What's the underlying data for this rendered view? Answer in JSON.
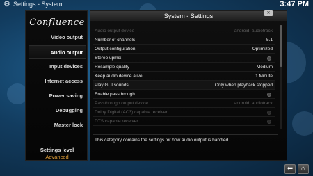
{
  "topbar": {
    "breadcrumb": "Settings - System",
    "clock": "3:47 PM"
  },
  "sidebar": {
    "logo": "Confluence",
    "items": [
      {
        "label": "Video output"
      },
      {
        "label": "Audio output"
      },
      {
        "label": "Input devices"
      },
      {
        "label": "Internet access"
      },
      {
        "label": "Power saving"
      },
      {
        "label": "Debugging"
      },
      {
        "label": "Master lock"
      }
    ],
    "active_index": 1,
    "settings_level_label": "Settings level",
    "settings_level_value": "Advanced"
  },
  "dialog": {
    "title": "System - Settings",
    "rows": [
      {
        "label": "Audio output device",
        "value": "android, audiotrack",
        "disabled": true
      },
      {
        "label": "Number of channels",
        "value": "5.1"
      },
      {
        "label": "Output configuration",
        "value": "Optimized"
      },
      {
        "label": "Stereo upmix",
        "value": ""
      },
      {
        "label": "Resample quality",
        "value": "Medium"
      },
      {
        "label": "Keep audio device alive",
        "value": "1 Minute"
      },
      {
        "label": "Play GUI sounds",
        "value": "Only when playback stopped"
      },
      {
        "label": "Enable passthrough",
        "value": ""
      },
      {
        "label": "Passthrough output device",
        "value": "android, audiotrack",
        "disabled": true
      },
      {
        "label": "Dolby Digital (AC3) capable receiver",
        "value": "",
        "disabled": true
      },
      {
        "label": "DTS capable receiver",
        "value": "",
        "disabled": true
      }
    ],
    "description": "This category contains the settings for how audio output is handled."
  },
  "navigation": {
    "back_icon": "back-arrow-icon",
    "home_icon": "home-icon"
  },
  "colors": {
    "accent": "#e3a13a",
    "background": "#123c5f"
  }
}
